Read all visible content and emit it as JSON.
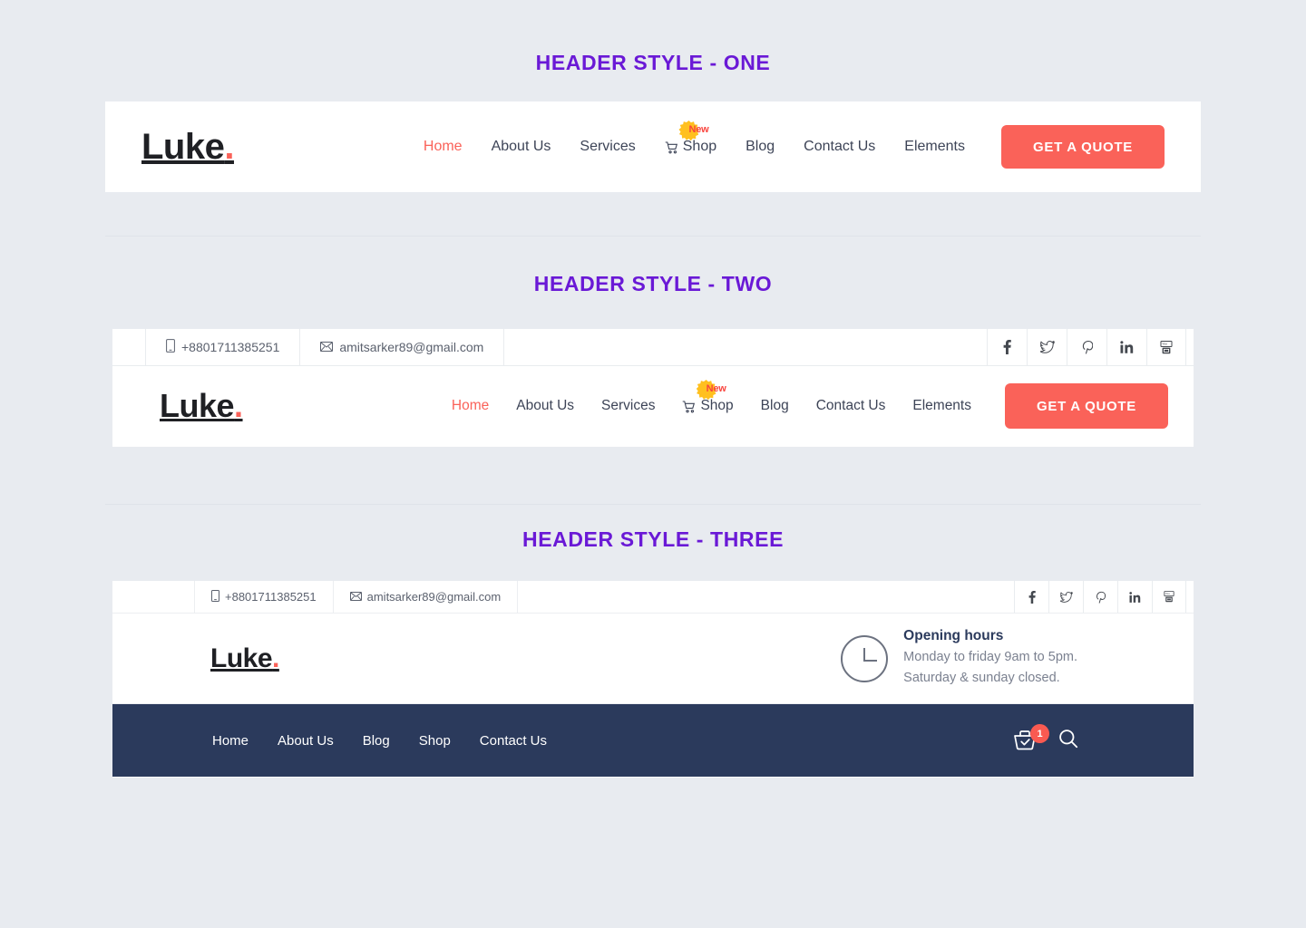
{
  "sections": [
    {
      "title": "HEADER STYLE - ONE"
    },
    {
      "title": "HEADER STYLE - TWO"
    },
    {
      "title": "HEADER STYLE - THREE"
    }
  ],
  "brand": {
    "name": "Luke",
    "dot": ".",
    "logo_color": "#1f2024",
    "dot_color": "#fa6259"
  },
  "colors": {
    "page_background": "#e8ebf0",
    "section_title": "#6a19d6",
    "accent_coral": "#fa6259",
    "navy": "#2b3a5c",
    "badge_yellow": "#ffc01f",
    "badge_text_red": "#f9443d"
  },
  "header_one": {
    "nav": [
      {
        "label": "Home",
        "active": true,
        "icon": null,
        "badge": null
      },
      {
        "label": "About Us",
        "active": false,
        "icon": null,
        "badge": null
      },
      {
        "label": "Services",
        "active": false,
        "icon": null,
        "badge": null
      },
      {
        "label": "Shop",
        "active": false,
        "icon": "cart-icon",
        "badge": "New"
      },
      {
        "label": "Blog",
        "active": false,
        "icon": null,
        "badge": null
      },
      {
        "label": "Contact Us",
        "active": false,
        "icon": null,
        "badge": null
      },
      {
        "label": "Elements",
        "active": false,
        "icon": null,
        "badge": null
      }
    ],
    "cta": "GET A QUOTE"
  },
  "header_two": {
    "topbar": {
      "phone": "+8801711385251",
      "email": "amitsarker89@gmail.com",
      "phone_icon": "mobile-phone-icon",
      "email_icon": "envelope-icon",
      "social": [
        {
          "name": "facebook-icon",
          "glyph": "f"
        },
        {
          "name": "twitter-icon",
          "glyph": "twitter"
        },
        {
          "name": "pinterest-icon",
          "glyph": "P"
        },
        {
          "name": "linkedin-icon",
          "glyph": "in"
        },
        {
          "name": "youtube-icon",
          "glyph": "youtube"
        }
      ]
    },
    "nav": [
      {
        "label": "Home",
        "active": true,
        "icon": null,
        "badge": null
      },
      {
        "label": "About Us",
        "active": false,
        "icon": null,
        "badge": null
      },
      {
        "label": "Services",
        "active": false,
        "icon": null,
        "badge": null
      },
      {
        "label": "Shop",
        "active": false,
        "icon": "cart-icon",
        "badge": "New"
      },
      {
        "label": "Blog",
        "active": false,
        "icon": null,
        "badge": null
      },
      {
        "label": "Contact Us",
        "active": false,
        "icon": null,
        "badge": null
      },
      {
        "label": "Elements",
        "active": false,
        "icon": null,
        "badge": null
      }
    ],
    "cta": "GET A QUOTE"
  },
  "header_three": {
    "topbar": {
      "phone": "+8801711385251",
      "email": "amitsarker89@gmail.com",
      "social": [
        {
          "name": "facebook-icon",
          "glyph": "f"
        },
        {
          "name": "twitter-icon",
          "glyph": "twitter"
        },
        {
          "name": "pinterest-icon",
          "glyph": "P"
        },
        {
          "name": "linkedin-icon",
          "glyph": "in"
        },
        {
          "name": "youtube-icon",
          "glyph": "youtube"
        }
      ]
    },
    "opening_hours": {
      "icon": "clock-icon",
      "title": "Opening hours",
      "line1": "Monday to friday 9am to 5pm.",
      "line2": "Saturday & sunday closed."
    },
    "nav": [
      {
        "label": "Home"
      },
      {
        "label": "About Us"
      },
      {
        "label": "Blog"
      },
      {
        "label": "Shop"
      },
      {
        "label": "Contact Us"
      }
    ],
    "cart": {
      "icon": "basket-icon",
      "count": "1"
    },
    "search": {
      "icon": "search-icon"
    }
  }
}
